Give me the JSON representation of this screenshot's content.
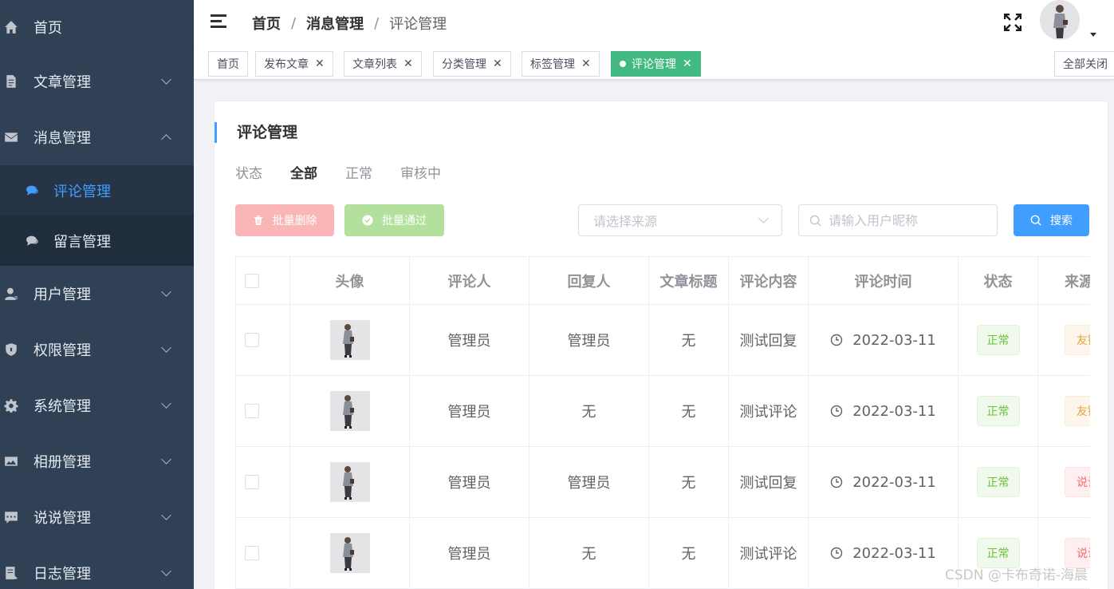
{
  "sidebar": {
    "items": [
      {
        "label": "首页",
        "icon": "home-icon"
      },
      {
        "label": "文章管理",
        "icon": "document-icon"
      },
      {
        "label": "消息管理",
        "icon": "mail-icon"
      },
      {
        "label": "评论管理",
        "icon": "chat-icon"
      },
      {
        "label": "留言管理",
        "icon": "chat-icon"
      },
      {
        "label": "用户管理",
        "icon": "user-icon"
      },
      {
        "label": "权限管理",
        "icon": "shield-icon"
      },
      {
        "label": "系统管理",
        "icon": "gear-icon"
      },
      {
        "label": "相册管理",
        "icon": "image-icon"
      },
      {
        "label": "说说管理",
        "icon": "message-icon"
      },
      {
        "label": "日志管理",
        "icon": "log-icon"
      }
    ],
    "active_color": "#409eff"
  },
  "header": {
    "breadcrumb": [
      "首页",
      "消息管理",
      "评论管理"
    ],
    "separator": "/"
  },
  "tags": {
    "items": [
      "首页",
      "发布文章",
      "文章列表",
      "分类管理",
      "标签管理",
      "评论管理"
    ],
    "close_symbol": "✕",
    "close_all": "全部关闭",
    "active_color": "#42b983"
  },
  "page": {
    "title": "评论管理",
    "status_label": "状态",
    "status_tabs": [
      "全部",
      "正常",
      "审核中"
    ],
    "batch_delete": "批量删除",
    "batch_pass": "批量通过",
    "source_placeholder": "请选择来源",
    "search_placeholder": "请输入用户昵称",
    "search_button": "搜索"
  },
  "table": {
    "headers": [
      "头像",
      "评论人",
      "回复人",
      "文章标题",
      "评论内容",
      "评论时间",
      "状态",
      "来源"
    ],
    "rows": [
      {
        "commenter": "管理员",
        "reply_to": "管理员",
        "article": "无",
        "content": "测试回复",
        "time": "2022-03-11",
        "status": "正常",
        "source": "友链"
      },
      {
        "commenter": "管理员",
        "reply_to": "无",
        "article": "无",
        "content": "测试评论",
        "time": "2022-03-11",
        "status": "正常",
        "source": "友链"
      },
      {
        "commenter": "管理员",
        "reply_to": "管理员",
        "article": "无",
        "content": "测试回复",
        "time": "2022-03-11",
        "status": "正常",
        "source": "说说"
      },
      {
        "commenter": "管理员",
        "reply_to": "无",
        "article": "无",
        "content": "测试评论",
        "time": "2022-03-11",
        "status": "正常",
        "source": "说说"
      }
    ]
  },
  "watermark": "CSDN @卡布奇诺-海晨"
}
